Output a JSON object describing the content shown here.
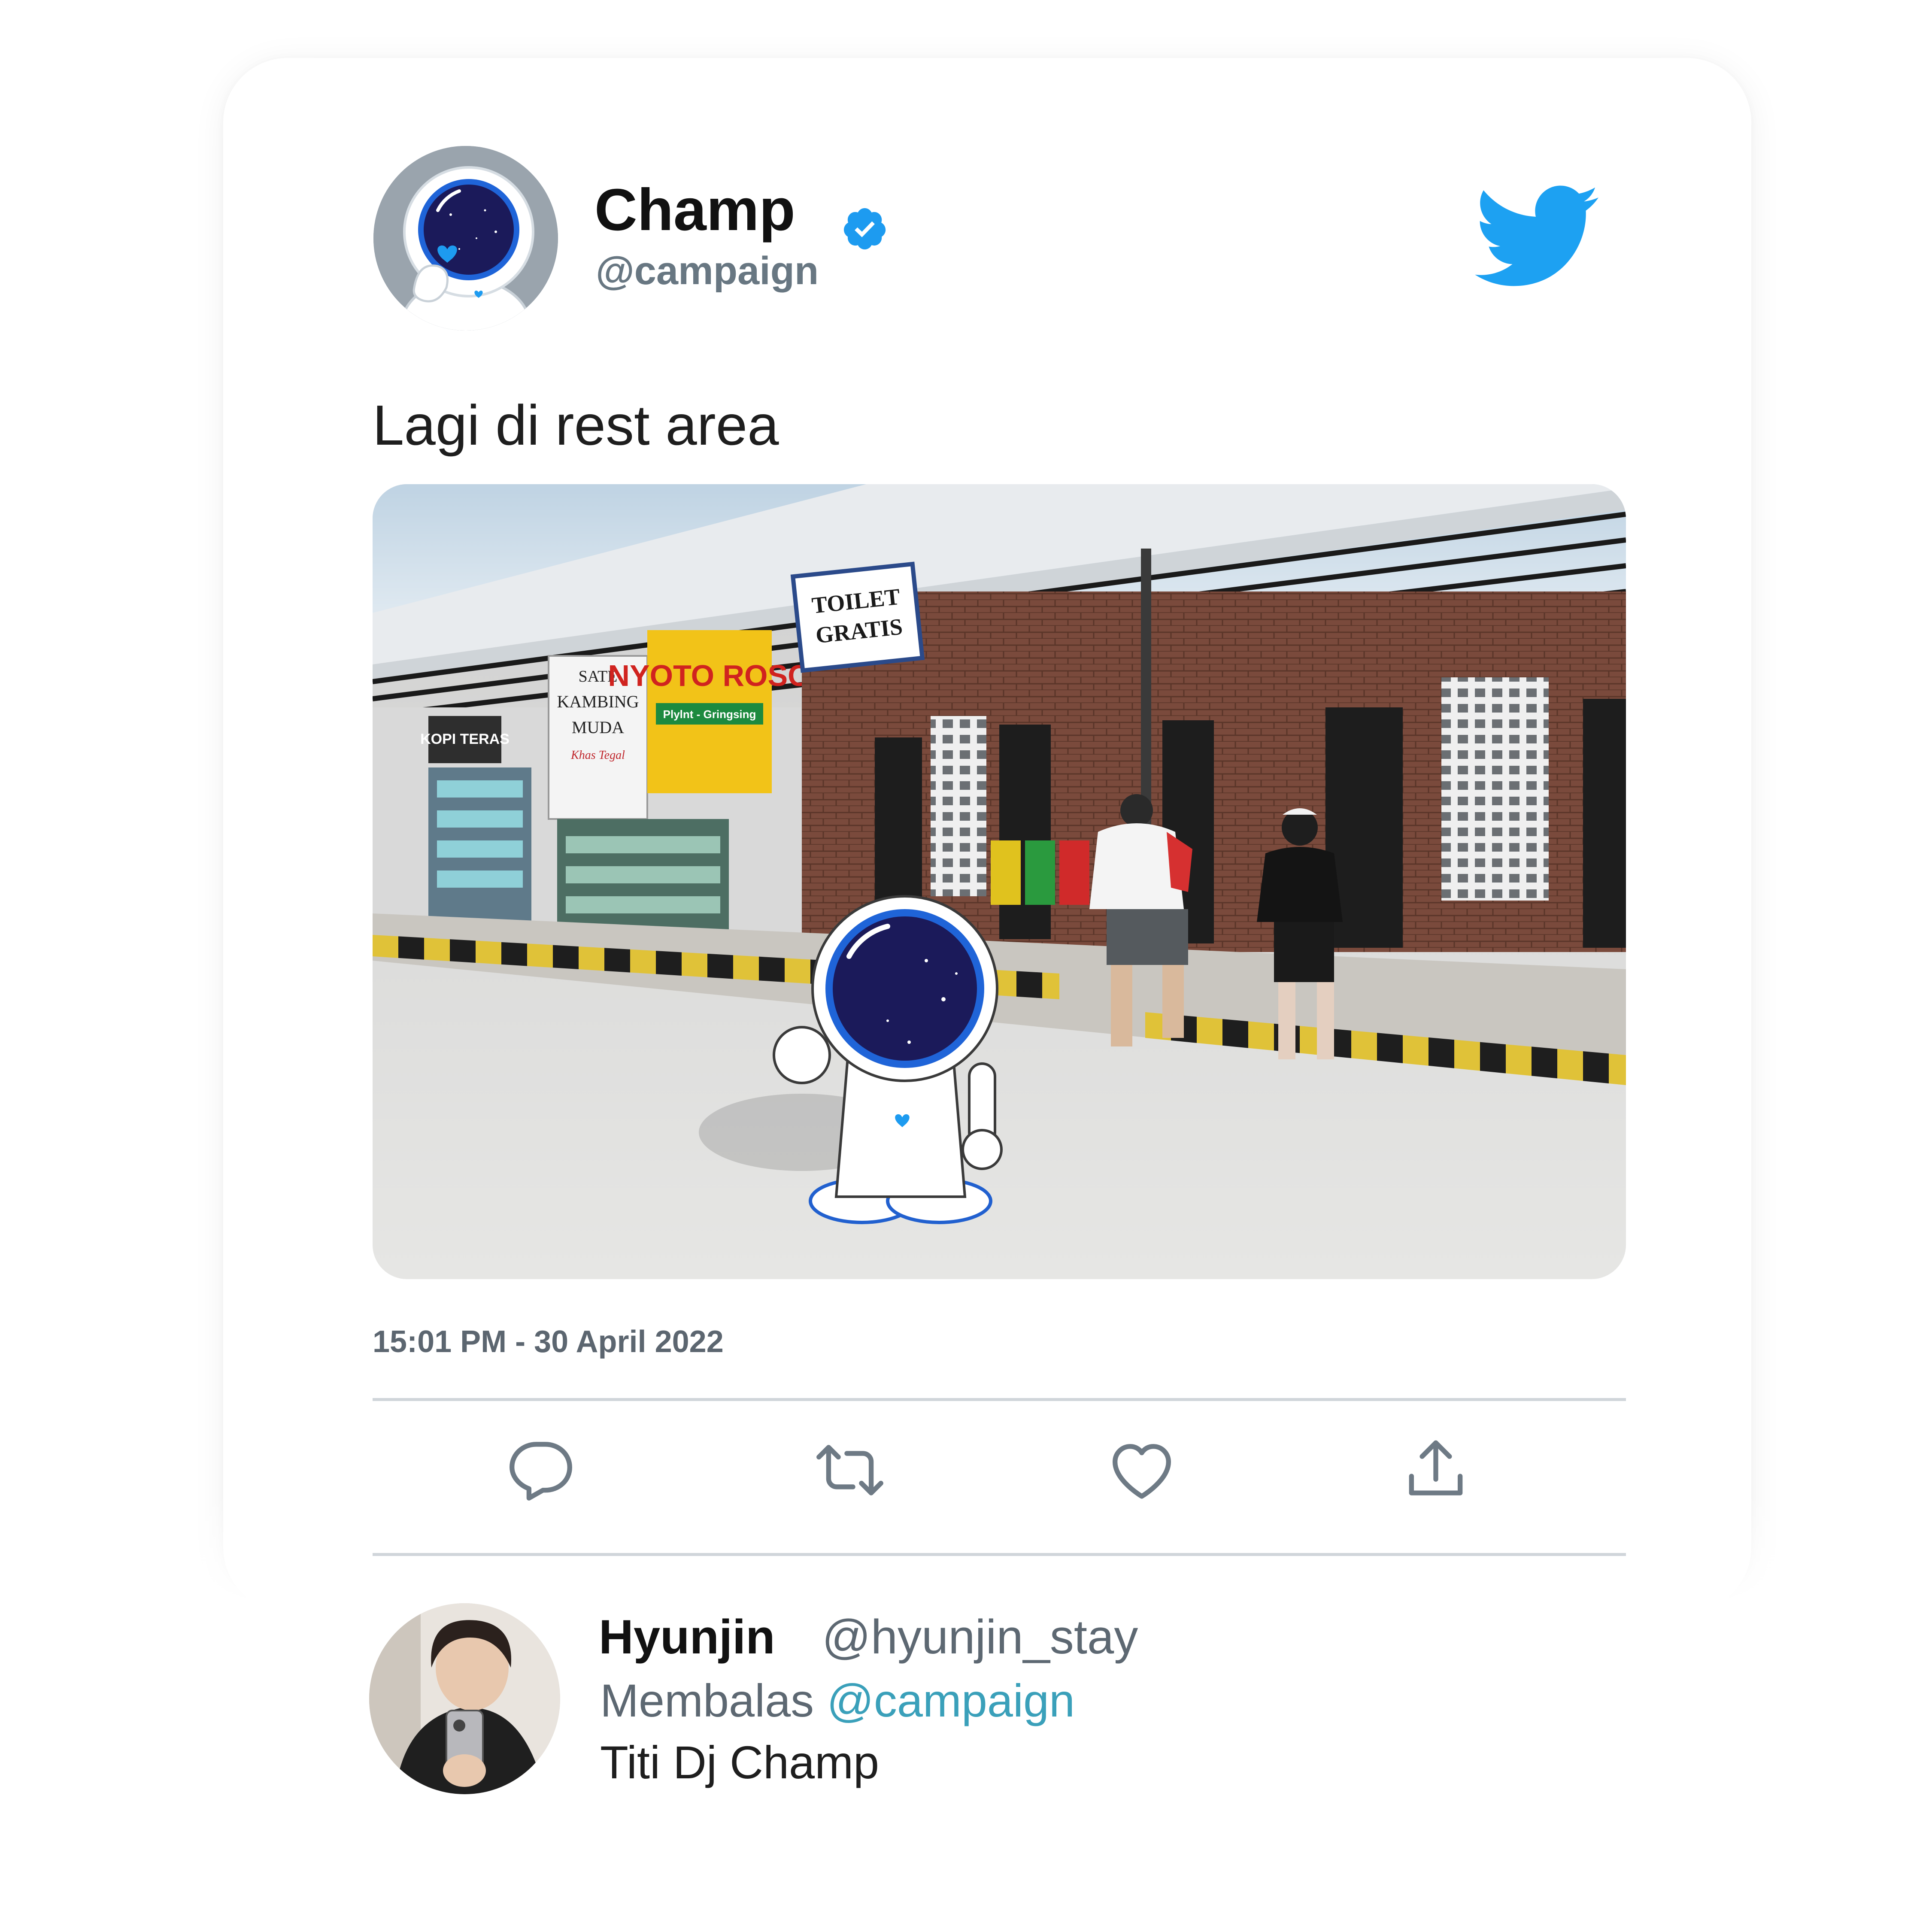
{
  "tweet": {
    "author_name": "Champ",
    "author_handle": "@campaign",
    "verified": true,
    "text": "Lagi di rest area",
    "timestamp": "15:01 PM - 30 April 2022",
    "image": {
      "signs": {
        "kopi": "KOPI TERAS",
        "sate_line1": "SATE",
        "sate_line2": "KAMBING",
        "sate_line3": "MUDA",
        "sate_line4": "Khas Tegal",
        "soto": "NYOTO ROSO",
        "soto_sub": "Plylnt - Gringsing",
        "toilet_line1": "TOILET",
        "toilet_line2": "GRATIS"
      }
    }
  },
  "actions": {
    "icons": [
      "reply-icon",
      "retweet-icon",
      "like-icon",
      "share-icon"
    ]
  },
  "reply": {
    "author_name": "Hyunjin",
    "author_handle": "@hyunjin_stay",
    "replying_prefix": "Membalas",
    "replying_to": "@campaign",
    "text": "Titi Dj Champ"
  },
  "colors": {
    "twitter_blue": "#1da1f2",
    "verified_blue": "#1d9bf0",
    "mention": "#3aa0ba",
    "secondary_text": "#687782",
    "divider": "#d0d5da",
    "icon_gray": "#6e7a85"
  }
}
